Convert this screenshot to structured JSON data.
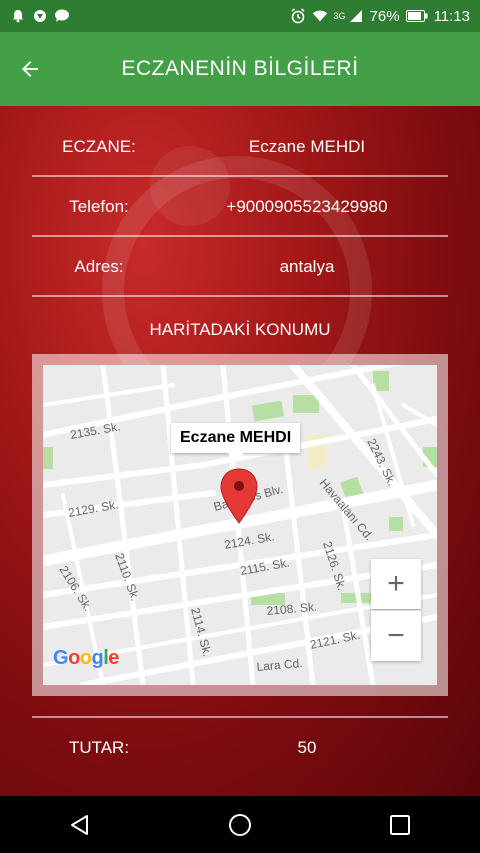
{
  "status_bar": {
    "battery": "76%",
    "time": "11:13",
    "network_label": "3G",
    "icons_left": [
      "notification-bell-icon",
      "shield-icon",
      "chat-bubble-icon"
    ],
    "icons_right": [
      "alarm-icon",
      "wifi-icon",
      "signal-icon",
      "battery-icon"
    ]
  },
  "app_bar": {
    "title": "ECZANENİN BİLGİLERİ"
  },
  "info": {
    "pharmacy_label": "ECZANE:",
    "pharmacy_value": "Eczane MEHDI",
    "phone_label": "Telefon:",
    "phone_value": "+9000905523429980",
    "address_label": "Adres:",
    "address_value": "antalya"
  },
  "map": {
    "heading": "HARİTADAKİ KONUMU",
    "marker_label": "Eczane MEHDI",
    "zoom_in": "+",
    "zoom_out": "−",
    "streets": [
      "2135. Sk.",
      "2129. Sk.",
      "Barbaros Blv.",
      "Havaalanı Cd.",
      "2243. Sk.",
      "2124. Sk.",
      "2115. Sk.",
      "2110. Sk.",
      "2106. Sk.",
      "2126. Sk.",
      "2108. Sk.",
      "2114. Sk.",
      "2121. Sk.",
      "Lara Cd."
    ],
    "google": [
      "G",
      "o",
      "o",
      "g",
      "l",
      "e"
    ]
  },
  "total": {
    "label": "TUTAR:",
    "value": "50"
  },
  "colors": {
    "status_bar": "#2e7d32",
    "app_bar": "#43a047",
    "background_red": "#a11717",
    "marker": "#e53935"
  }
}
